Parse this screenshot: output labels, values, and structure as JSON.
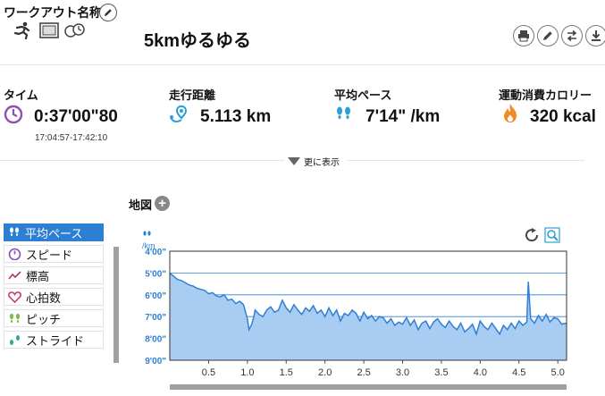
{
  "header": {
    "label": "ワークアウト名称",
    "workout_name": "5kmゆるゆる"
  },
  "icons": {
    "header": [
      "runner-icon",
      "film-icon",
      "stopwatch-icon"
    ],
    "actions": [
      "print-icon",
      "edit-icon",
      "swap-icon",
      "download-icon",
      "more-icon"
    ]
  },
  "stats": {
    "time": {
      "label": "タイム",
      "value": "0:37'00\"80",
      "sub": "17:04:57-17:42:10"
    },
    "distance": {
      "label": "走行距離",
      "value": "5.113 km"
    },
    "pace": {
      "label": "平均ペース",
      "value": "7'14\" /km"
    },
    "calories": {
      "label": "運動消費カロリー",
      "value": "320 kcal"
    }
  },
  "more_toggle": "更に表示",
  "map": {
    "label": "地図"
  },
  "metrics": [
    {
      "label": "平均ペース",
      "active": true
    },
    {
      "label": "スピード",
      "active": false
    },
    {
      "label": "標高",
      "active": false
    },
    {
      "label": "心拍数",
      "active": false
    },
    {
      "label": "ピッチ",
      "active": false
    },
    {
      "label": "ストライド",
      "active": false
    }
  ],
  "colors": {
    "accent": "#2d7fd3",
    "pace_icon": "#2b9fd6",
    "time_icon": "#8e4fb5",
    "calorie_icon": "#f08a24",
    "chart_fill": "#a9cdf2",
    "chart_line": "#2f7fd6"
  },
  "chart_data": {
    "type": "area",
    "unit_label": "/km",
    "x_ticks": [
      "0.5",
      "1.0",
      "1.5",
      "2.0",
      "2.5",
      "3.0",
      "3.5",
      "4.0",
      "4.5",
      "5.0"
    ],
    "y_ticks": [
      "4'00\"",
      "5'00\"",
      "6'00\"",
      "7'00\"",
      "8'00\"",
      "9'00\""
    ],
    "xlim": [
      0,
      5.113
    ],
    "ylim_minutes": [
      4,
      9
    ],
    "y_inverted": true,
    "x": [
      0.0,
      0.05,
      0.1,
      0.15,
      0.2,
      0.25,
      0.3,
      0.35,
      0.4,
      0.45,
      0.5,
      0.55,
      0.6,
      0.65,
      0.7,
      0.75,
      0.8,
      0.85,
      0.9,
      0.95,
      1.0,
      1.02,
      1.05,
      1.08,
      1.1,
      1.15,
      1.2,
      1.25,
      1.3,
      1.35,
      1.4,
      1.45,
      1.5,
      1.55,
      1.6,
      1.65,
      1.7,
      1.75,
      1.8,
      1.85,
      1.9,
      1.95,
      2.0,
      2.05,
      2.1,
      2.15,
      2.2,
      2.25,
      2.3,
      2.35,
      2.4,
      2.45,
      2.5,
      2.55,
      2.6,
      2.65,
      2.7,
      2.75,
      2.8,
      2.85,
      2.9,
      2.95,
      3.0,
      3.05,
      3.1,
      3.15,
      3.2,
      3.25,
      3.3,
      3.35,
      3.4,
      3.45,
      3.5,
      3.55,
      3.6,
      3.65,
      3.7,
      3.75,
      3.8,
      3.85,
      3.9,
      3.95,
      4.0,
      4.05,
      4.1,
      4.15,
      4.2,
      4.25,
      4.3,
      4.35,
      4.4,
      4.45,
      4.5,
      4.55,
      4.6,
      4.62,
      4.65,
      4.7,
      4.75,
      4.8,
      4.85,
      4.9,
      4.95,
      5.0,
      5.05,
      5.11
    ],
    "y": [
      5.0,
      5.15,
      5.3,
      5.35,
      5.45,
      5.55,
      5.6,
      5.7,
      5.75,
      5.8,
      5.95,
      5.9,
      6.05,
      6.1,
      6.0,
      6.25,
      6.2,
      6.4,
      6.3,
      6.45,
      7.1,
      7.6,
      7.4,
      7.05,
      6.7,
      6.9,
      7.0,
      6.7,
      6.55,
      6.8,
      6.7,
      6.25,
      6.6,
      6.8,
      6.45,
      6.7,
      6.9,
      6.6,
      6.75,
      6.5,
      6.85,
      6.7,
      7.0,
      6.6,
      6.95,
      6.7,
      7.2,
      6.85,
      6.95,
      6.7,
      6.85,
      7.2,
      6.8,
      7.1,
      6.95,
      7.2,
      7.0,
      7.05,
      7.3,
      7.1,
      7.4,
      7.25,
      7.35,
      7.05,
      7.4,
      7.15,
      7.6,
      7.3,
      7.2,
      7.55,
      7.25,
      7.1,
      7.35,
      7.5,
      7.2,
      7.45,
      7.6,
      7.3,
      7.7,
      7.55,
      7.35,
      7.8,
      7.2,
      7.45,
      7.6,
      7.3,
      7.55,
      7.8,
      7.4,
      7.6,
      7.3,
      7.55,
      7.2,
      7.4,
      7.25,
      5.4,
      7.1,
      7.3,
      6.95,
      7.2,
      6.9,
      7.25,
      7.05,
      7.1,
      7.35,
      7.3
    ],
    "grid": true
  }
}
